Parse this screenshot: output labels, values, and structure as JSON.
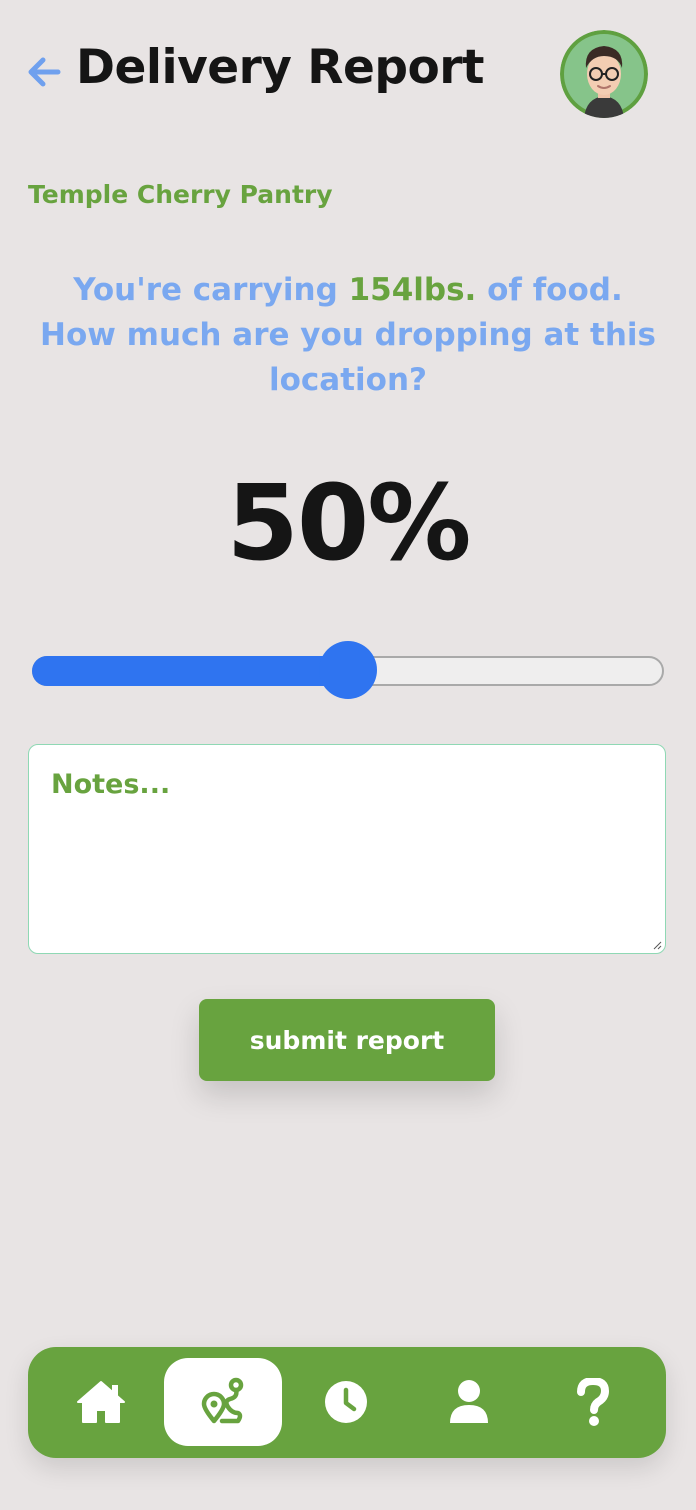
{
  "header": {
    "title": "Delivery Report",
    "back_icon": "arrow-left-icon",
    "avatar_icon": "user-avatar"
  },
  "location": {
    "name": "Temple Cherry Pantry"
  },
  "question": {
    "prefix": "You're carrying ",
    "amount": "154lbs.",
    "suffix": " of food. How much are you dropping at this location?"
  },
  "drop": {
    "percent_label": "50%",
    "value_fraction": 0.5
  },
  "notes": {
    "placeholder": "Notes...",
    "value": ""
  },
  "submit": {
    "label": "submit report"
  },
  "nav": {
    "items": [
      {
        "icon": "home-icon",
        "active": false
      },
      {
        "icon": "route-icon",
        "active": true
      },
      {
        "icon": "clock-icon",
        "active": false
      },
      {
        "icon": "user-icon",
        "active": false
      },
      {
        "icon": "question-icon",
        "active": false
      }
    ]
  },
  "colors": {
    "accent_green": "#68a33f",
    "accent_blue": "#2f74f0",
    "question_blue": "#7aa8f0",
    "background": "#e8e4e4"
  }
}
